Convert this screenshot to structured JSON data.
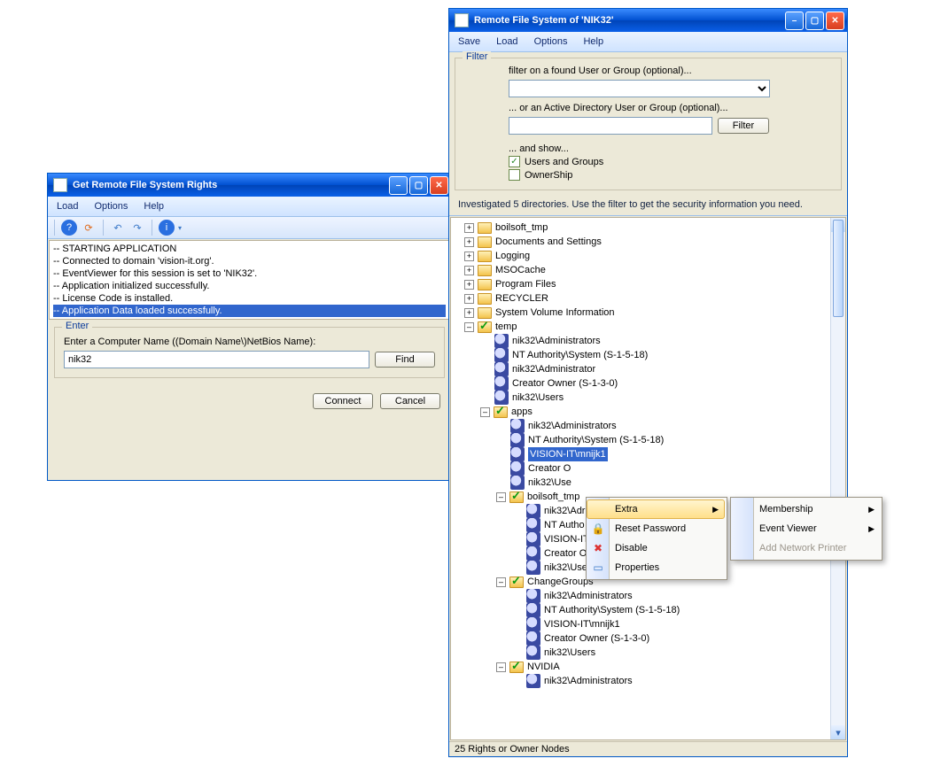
{
  "left": {
    "title": "Get Remote File System Rights",
    "menu": [
      "Load",
      "Options",
      "Help"
    ],
    "log": [
      "-- STARTING APPLICATION",
      "",
      "-- Connected to domain 'vision-it.org'.",
      "-- EventViewer for this session is set to 'NIK32'.",
      "-- Application initialized successfully.",
      "-- License Code is installed.",
      "-- Application Data loaded successfully."
    ],
    "enter": {
      "legend": "Enter",
      "prompt": "Enter a Computer Name ((Domain Name\\)NetBios Name):",
      "value": "nik32",
      "find": "Find"
    },
    "connect": "Connect",
    "cancel": "Cancel"
  },
  "right": {
    "title": "Remote File System of 'NIK32'",
    "menu": [
      "Save",
      "Load",
      "Options",
      "Help"
    ],
    "filter": {
      "legend": "Filter",
      "l1": "filter on a found User or Group (optional)...",
      "l2": "... or an Active Directory User or Group (optional)...",
      "btn": "Filter",
      "l3": "... and show...",
      "chk1": "Users and Groups",
      "chk2": "OwnerShip"
    },
    "info": "Investigated 5 directories. Use the filter to get the security information you need.",
    "status": "25 Rights or Owner Nodes",
    "tree": [
      {
        "d": 0,
        "t": "plus",
        "i": "folder",
        "l": "boilsoft_tmp"
      },
      {
        "d": 0,
        "t": "plus",
        "i": "folder",
        "l": "Documents and Settings"
      },
      {
        "d": 0,
        "t": "plus",
        "i": "folder",
        "l": "Logging"
      },
      {
        "d": 0,
        "t": "plus",
        "i": "folder",
        "l": "MSOCache"
      },
      {
        "d": 0,
        "t": "plus",
        "i": "folder",
        "l": "Program Files"
      },
      {
        "d": 0,
        "t": "plus",
        "i": "folder",
        "l": "RECYCLER"
      },
      {
        "d": 0,
        "t": "plus",
        "i": "folder",
        "l": "System Volume Information"
      },
      {
        "d": 0,
        "t": "minus",
        "i": "check",
        "l": "temp"
      },
      {
        "d": 1,
        "t": "",
        "i": "user",
        "l": "nik32\\Administrators"
      },
      {
        "d": 1,
        "t": "",
        "i": "user",
        "l": "NT Authority\\System (S-1-5-18)"
      },
      {
        "d": 1,
        "t": "",
        "i": "user",
        "l": "nik32\\Administrator"
      },
      {
        "d": 1,
        "t": "",
        "i": "user",
        "l": "Creator Owner (S-1-3-0)"
      },
      {
        "d": 1,
        "t": "",
        "i": "user",
        "l": "nik32\\Users"
      },
      {
        "d": 1,
        "t": "minus",
        "i": "check",
        "l": "apps"
      },
      {
        "d": 2,
        "t": "",
        "i": "user",
        "l": "nik32\\Administrators"
      },
      {
        "d": 2,
        "t": "",
        "i": "user",
        "l": "NT Authority\\System (S-1-5-18)"
      },
      {
        "d": 2,
        "t": "",
        "i": "user",
        "l": "VISION-IT\\mnijk1",
        "sel": true
      },
      {
        "d": 2,
        "t": "",
        "i": "user",
        "l": "Creator O"
      },
      {
        "d": 2,
        "t": "",
        "i": "user",
        "l": "nik32\\Use"
      },
      {
        "d": 2,
        "t": "minus",
        "i": "check",
        "l": "boilsoft_tmp"
      },
      {
        "d": 3,
        "t": "",
        "i": "user",
        "l": "nik32\\Adr"
      },
      {
        "d": 3,
        "t": "",
        "i": "user",
        "l": "NT Autho"
      },
      {
        "d": 3,
        "t": "",
        "i": "user",
        "l": "VISION-IT"
      },
      {
        "d": 3,
        "t": "",
        "i": "user",
        "l": "Creator Owner (S-1-3-0)"
      },
      {
        "d": 3,
        "t": "",
        "i": "user",
        "l": "nik32\\Users"
      },
      {
        "d": 2,
        "t": "minus",
        "i": "check",
        "l": "ChangeGroups"
      },
      {
        "d": 3,
        "t": "",
        "i": "user",
        "l": "nik32\\Administrators"
      },
      {
        "d": 3,
        "t": "",
        "i": "user",
        "l": "NT Authority\\System (S-1-5-18)"
      },
      {
        "d": 3,
        "t": "",
        "i": "user",
        "l": "VISION-IT\\mnijk1"
      },
      {
        "d": 3,
        "t": "",
        "i": "user",
        "l": "Creator Owner (S-1-3-0)"
      },
      {
        "d": 3,
        "t": "",
        "i": "user",
        "l": "nik32\\Users"
      },
      {
        "d": 2,
        "t": "minus",
        "i": "check",
        "l": "NVIDIA"
      },
      {
        "d": 3,
        "t": "",
        "i": "user",
        "l": "nik32\\Administrators"
      }
    ]
  },
  "ctx1": {
    "items": [
      {
        "l": "Extra",
        "arrow": true,
        "hov": true
      },
      {
        "l": "Reset Password",
        "ico": "lock"
      },
      {
        "l": "Disable",
        "ico": "x"
      },
      {
        "l": "Properties",
        "ico": "prop"
      }
    ]
  },
  "ctx2": {
    "items": [
      {
        "l": "Membership",
        "arrow": true
      },
      {
        "l": "Event Viewer",
        "arrow": true
      },
      {
        "l": "Add Network Printer",
        "disabled": true
      }
    ]
  }
}
